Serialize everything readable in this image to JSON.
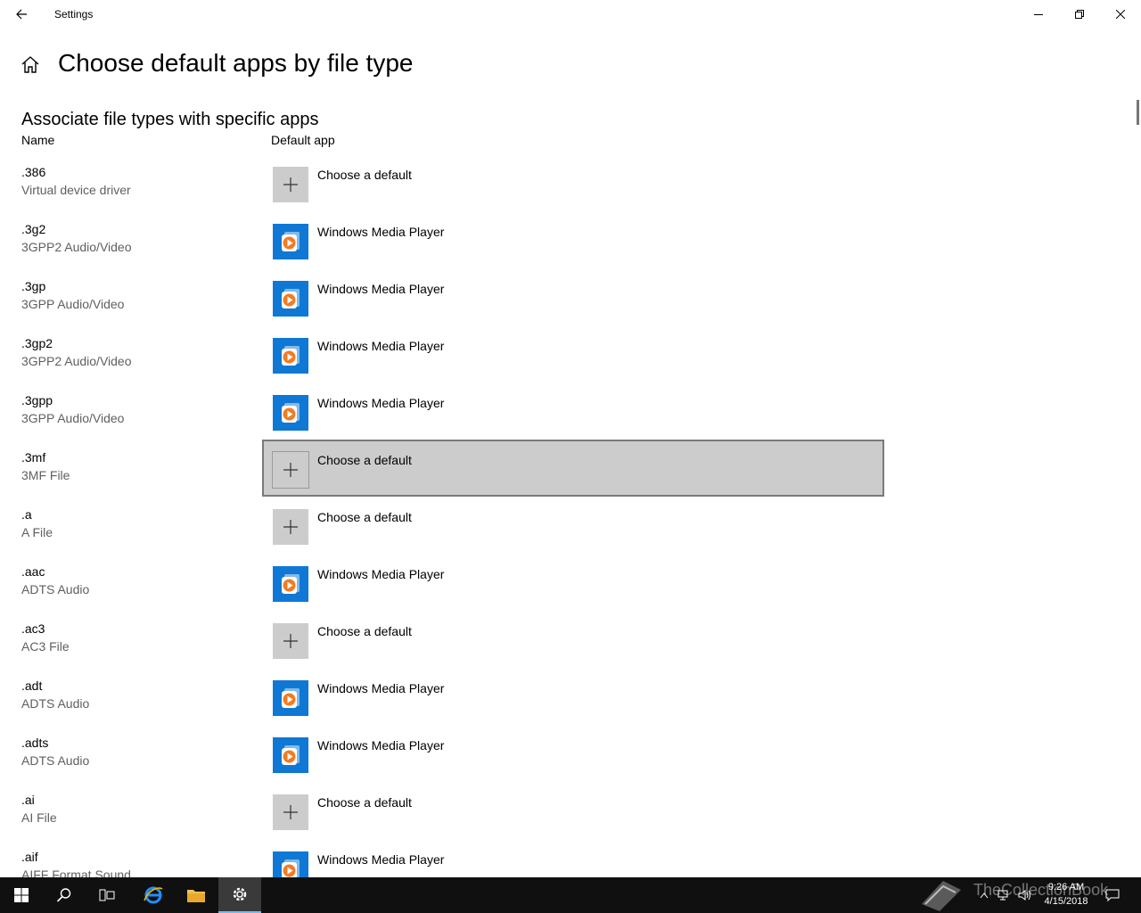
{
  "window": {
    "title": "Settings"
  },
  "header": {
    "page_title": "Choose default apps by file type",
    "section_title": "Associate file types with specific apps",
    "col_name": "Name",
    "col_app": "Default app"
  },
  "rows": [
    {
      "ext": ".386",
      "desc": "Virtual device driver",
      "app": "Choose a default",
      "icon": "plus-icon"
    },
    {
      "ext": ".3g2",
      "desc": "3GPP2 Audio/Video",
      "app": "Windows Media Player",
      "icon": "windows-media-player-icon"
    },
    {
      "ext": ".3gp",
      "desc": "3GPP Audio/Video",
      "app": "Windows Media Player",
      "icon": "windows-media-player-icon"
    },
    {
      "ext": ".3gp2",
      "desc": "3GPP2 Audio/Video",
      "app": "Windows Media Player",
      "icon": "windows-media-player-icon"
    },
    {
      "ext": ".3gpp",
      "desc": "3GPP Audio/Video",
      "app": "Windows Media Player",
      "icon": "windows-media-player-icon"
    },
    {
      "ext": ".3mf",
      "desc": "3MF File",
      "app": "Choose a default",
      "icon": "plus-icon",
      "selected": true
    },
    {
      "ext": ".a",
      "desc": "A File",
      "app": "Choose a default",
      "icon": "plus-icon"
    },
    {
      "ext": ".aac",
      "desc": "ADTS Audio",
      "app": "Windows Media Player",
      "icon": "windows-media-player-icon"
    },
    {
      "ext": ".ac3",
      "desc": "AC3 File",
      "app": "Choose a default",
      "icon": "plus-icon"
    },
    {
      "ext": ".adt",
      "desc": "ADTS Audio",
      "app": "Windows Media Player",
      "icon": "windows-media-player-icon"
    },
    {
      "ext": ".adts",
      "desc": "ADTS Audio",
      "app": "Windows Media Player",
      "icon": "windows-media-player-icon"
    },
    {
      "ext": ".ai",
      "desc": "AI File",
      "app": "Choose a default",
      "icon": "plus-icon"
    },
    {
      "ext": ".aif",
      "desc": "AIFF Format Sound",
      "app": "Windows Media Player",
      "icon": "windows-media-player-icon"
    }
  ],
  "taskbar": {
    "time": "9:26 AM",
    "date": "4/15/2018",
    "watermark": "TheCollectionBook",
    "active_app": "settings"
  },
  "colors": {
    "accent": "#0f78d4",
    "selected_bg": "#cccccc",
    "taskbar_bg": "#101010"
  }
}
